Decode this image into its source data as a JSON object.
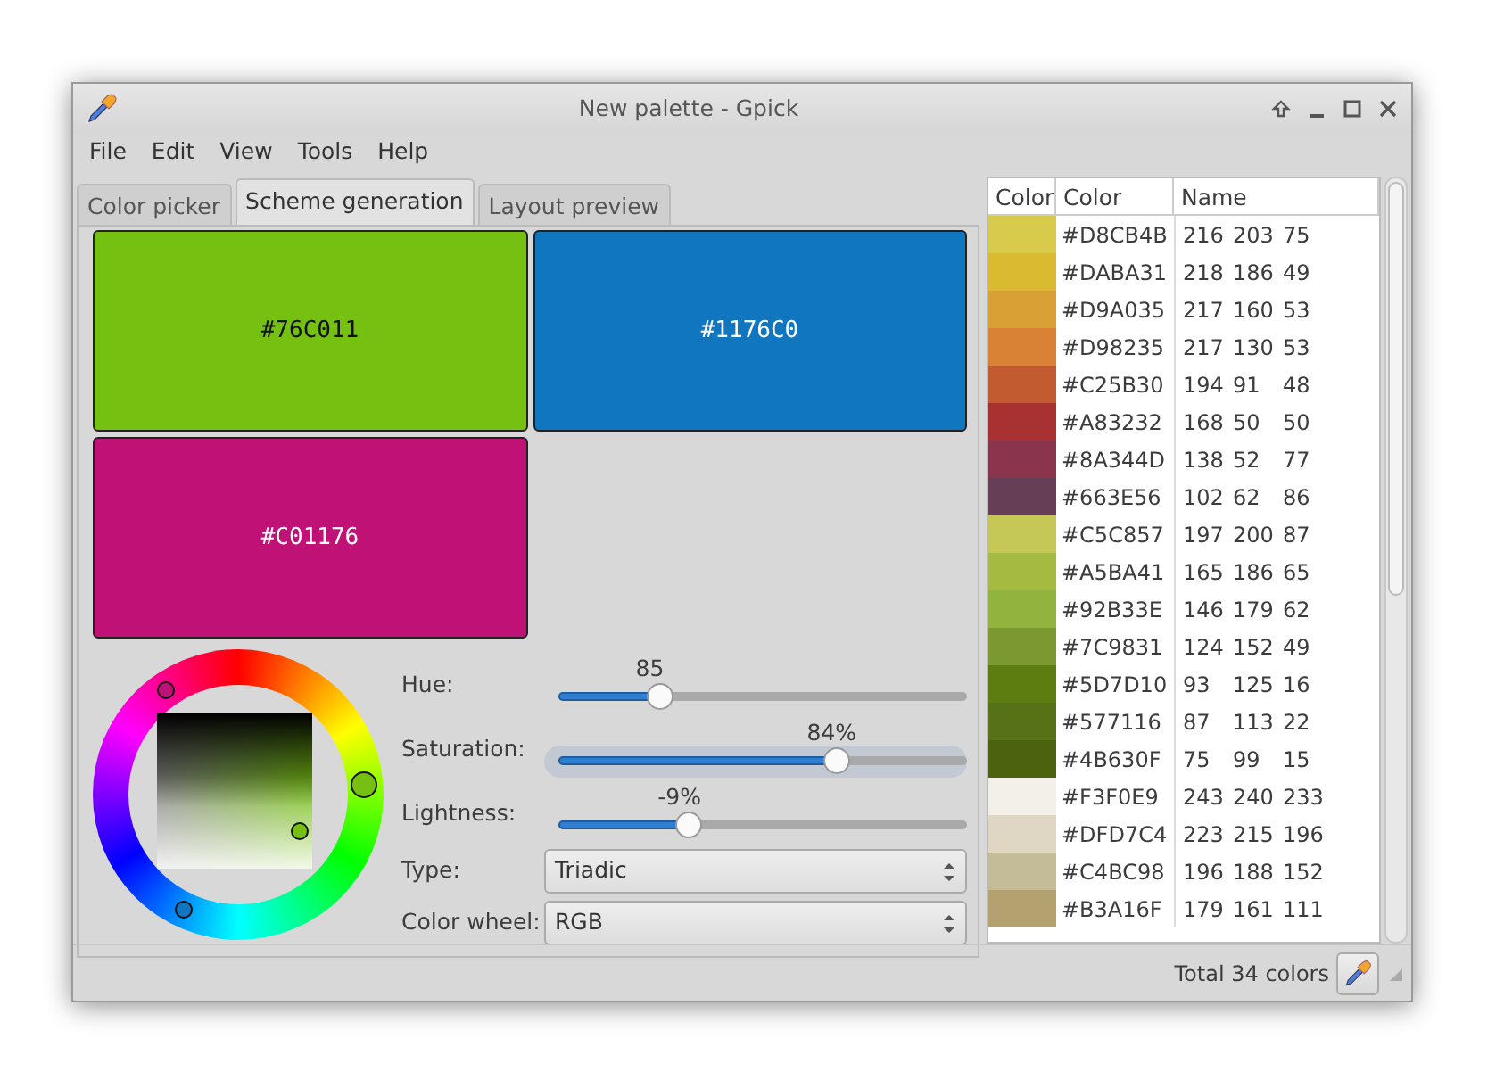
{
  "window": {
    "title": "New palette - Gpick"
  },
  "menu": [
    "File",
    "Edit",
    "View",
    "Tools",
    "Help"
  ],
  "tabs": [
    {
      "label": "Color picker",
      "selected": false
    },
    {
      "label": "Scheme generation",
      "selected": true
    },
    {
      "label": "Layout preview",
      "selected": false
    }
  ],
  "scheme": {
    "swatches": [
      {
        "hex": "#76C011",
        "color": "#76c011"
      },
      {
        "hex": "#1176C0",
        "color": "#1176c0"
      },
      {
        "hex": "#C01176",
        "color": "#c01176"
      }
    ]
  },
  "sliders": [
    {
      "label": "Hue:",
      "value": "85",
      "level": 0.25,
      "focused": false
    },
    {
      "label": "Saturation:",
      "value": "84%",
      "level": 0.68,
      "focused": true
    },
    {
      "label": "Lightness:",
      "value": "-9%",
      "level": 0.32,
      "focused": false
    }
  ],
  "selects": [
    {
      "label": "Type:",
      "value": "Triadic"
    },
    {
      "label": "Color wheel:",
      "value": "RGB"
    }
  ],
  "palette": {
    "columns": [
      "Color",
      "Color",
      "Name"
    ],
    "rows": [
      {
        "color": "#d8cb4b",
        "hex": "#D8CB4B",
        "rgb": [
          "216",
          "203",
          "75"
        ]
      },
      {
        "color": "#daba31",
        "hex": "#DABA31",
        "rgb": [
          "218",
          "186",
          "49"
        ]
      },
      {
        "color": "#d9a035",
        "hex": "#D9A035",
        "rgb": [
          "217",
          "160",
          "53"
        ]
      },
      {
        "color": "#d98235",
        "hex": "#D98235",
        "rgb": [
          "217",
          "130",
          "53"
        ]
      },
      {
        "color": "#c25b30",
        "hex": "#C25B30",
        "rgb": [
          "194",
          "91",
          "48"
        ]
      },
      {
        "color": "#a83232",
        "hex": "#A83232",
        "rgb": [
          "168",
          "50",
          "50"
        ]
      },
      {
        "color": "#8a344d",
        "hex": "#8A344D",
        "rgb": [
          "138",
          "52",
          "77"
        ]
      },
      {
        "color": "#663e56",
        "hex": "#663E56",
        "rgb": [
          "102",
          "62",
          "86"
        ]
      },
      {
        "color": "#c5c857",
        "hex": "#C5C857",
        "rgb": [
          "197",
          "200",
          "87"
        ]
      },
      {
        "color": "#a5ba41",
        "hex": "#A5BA41",
        "rgb": [
          "165",
          "186",
          "65"
        ]
      },
      {
        "color": "#92b33e",
        "hex": "#92B33E",
        "rgb": [
          "146",
          "179",
          "62"
        ]
      },
      {
        "color": "#7c9831",
        "hex": "#7C9831",
        "rgb": [
          "124",
          "152",
          "49"
        ]
      },
      {
        "color": "#5d7d10",
        "hex": "#5D7D10",
        "rgb": [
          "93",
          "125",
          "16"
        ]
      },
      {
        "color": "#577116",
        "hex": "#577116",
        "rgb": [
          "87",
          "113",
          "22"
        ]
      },
      {
        "color": "#4b630f",
        "hex": "#4B630F",
        "rgb": [
          "75",
          "99",
          "15"
        ]
      },
      {
        "color": "#f3f0e9",
        "hex": "#F3F0E9",
        "rgb": [
          "243",
          "240",
          "233"
        ]
      },
      {
        "color": "#dfd7c4",
        "hex": "#DFD7C4",
        "rgb": [
          "223",
          "215",
          "196"
        ]
      },
      {
        "color": "#c4bc98",
        "hex": "#C4BC98",
        "rgb": [
          "196",
          "188",
          "152"
        ]
      },
      {
        "color": "#b3a16f",
        "hex": "#B3A16F",
        "rgb": [
          "179",
          "161",
          "111"
        ]
      }
    ]
  },
  "status_bar": {
    "text": "Total 34 colors"
  }
}
